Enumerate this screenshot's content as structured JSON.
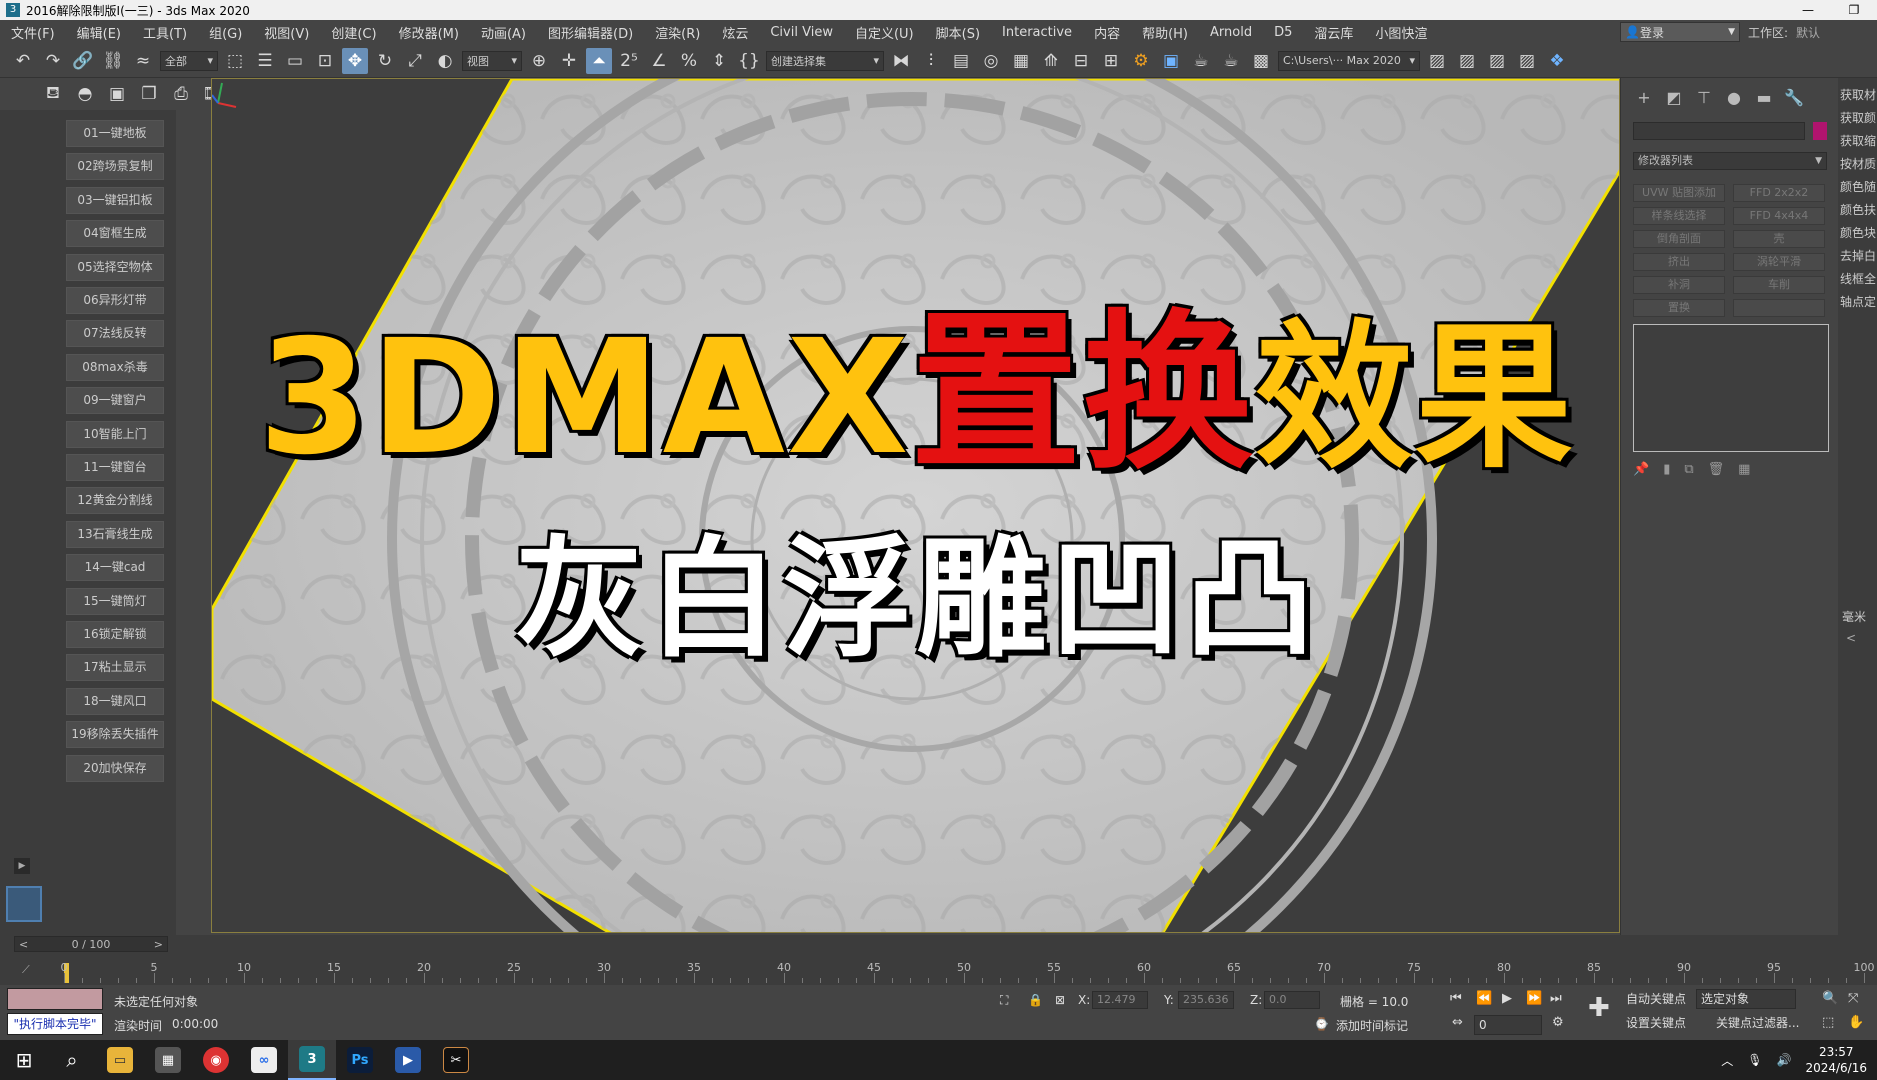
{
  "window": {
    "title": "2016解除限制版I(一三) - 3ds Max 2020",
    "app_icon": "3"
  },
  "menu": [
    "文件(F)",
    "编辑(E)",
    "工具(T)",
    "组(G)",
    "视图(V)",
    "创建(C)",
    "修改器(M)",
    "动画(A)",
    "图形编辑器(D)",
    "渲染(R)",
    "炫云",
    "Civil View",
    "自定义(U)",
    "脚本(S)",
    "Interactive",
    "内容",
    "帮助(H)",
    "Arnold",
    "D5",
    "溜云库",
    "小图快渲"
  ],
  "login": "登录",
  "workspace": {
    "label": "工作区:",
    "value": "默认"
  },
  "toolbar": {
    "selection_filter": "全部",
    "ref_coord": "视图",
    "named_selection": "创建选择集",
    "path": "C:\\Users\\··· Max 2020"
  },
  "left_panel": {
    "script_buttons": [
      "01一键地板",
      "02跨场景复制",
      "03一键铝扣板",
      "04窗框生成",
      "05选择空物体",
      "06异形灯带",
      "07法线反转",
      "08max杀毒",
      "09一键窗户",
      "10智能上门",
      "11一键窗台",
      "12黄金分割线",
      "13石膏线生成",
      "14一键cad",
      "15一键筒灯",
      "16锁定解锁",
      "17粘土显示",
      "18一键风口",
      "19移除丢失插件",
      "20加快保存"
    ]
  },
  "viewport": {
    "title_part1": "3DMAX",
    "title_part2": "置换",
    "title_part3": "效果",
    "subtitle": "灰白浮雕凹凸"
  },
  "command_panel": {
    "modifier_list": "修改器列表",
    "modifiers": [
      "UVW 贴图添加",
      "FFD 2x2x2",
      "样条线选择",
      "FFD 4x4x4",
      "倒角剖面",
      "壳",
      "挤出",
      "涡轮平滑",
      "补洞",
      "车削",
      "置换",
      ""
    ]
  },
  "side_column": {
    "items": [
      "获取材",
      "获取颜",
      "获取缩",
      "按材质",
      "颜色随",
      "颜色扶",
      "颜色块",
      "去掉白",
      "线框全",
      "轴点定"
    ],
    "unit": "毫米"
  },
  "timeline": {
    "slider": "0 / 100",
    "ticks": [
      "0",
      "5",
      "10",
      "15",
      "20",
      "25",
      "30",
      "35",
      "40",
      "45",
      "50",
      "55",
      "60",
      "65",
      "70",
      "75",
      "80",
      "85",
      "90",
      "95",
      "100"
    ]
  },
  "status": {
    "script_done": "\"执行脚本完毕\"",
    "selection": "未选定任何对象",
    "render_time_label": "渲染时间",
    "render_time": "0:00:00",
    "x_label": "X:",
    "x_val": "12.479",
    "y_label": "Y:",
    "y_val": "235.636",
    "z_label": "Z:",
    "z_val": "0.0",
    "grid": "栅格 = 10.0",
    "add_time_tag": "添加时间标记",
    "frame": "0",
    "auto_key": "自动关键点",
    "selected_obj": "选定对象",
    "set_key": "设置关键点",
    "key_filter": "关键点过滤器..."
  },
  "taskbar": {
    "time": "23:57",
    "date": "2024/6/16"
  }
}
